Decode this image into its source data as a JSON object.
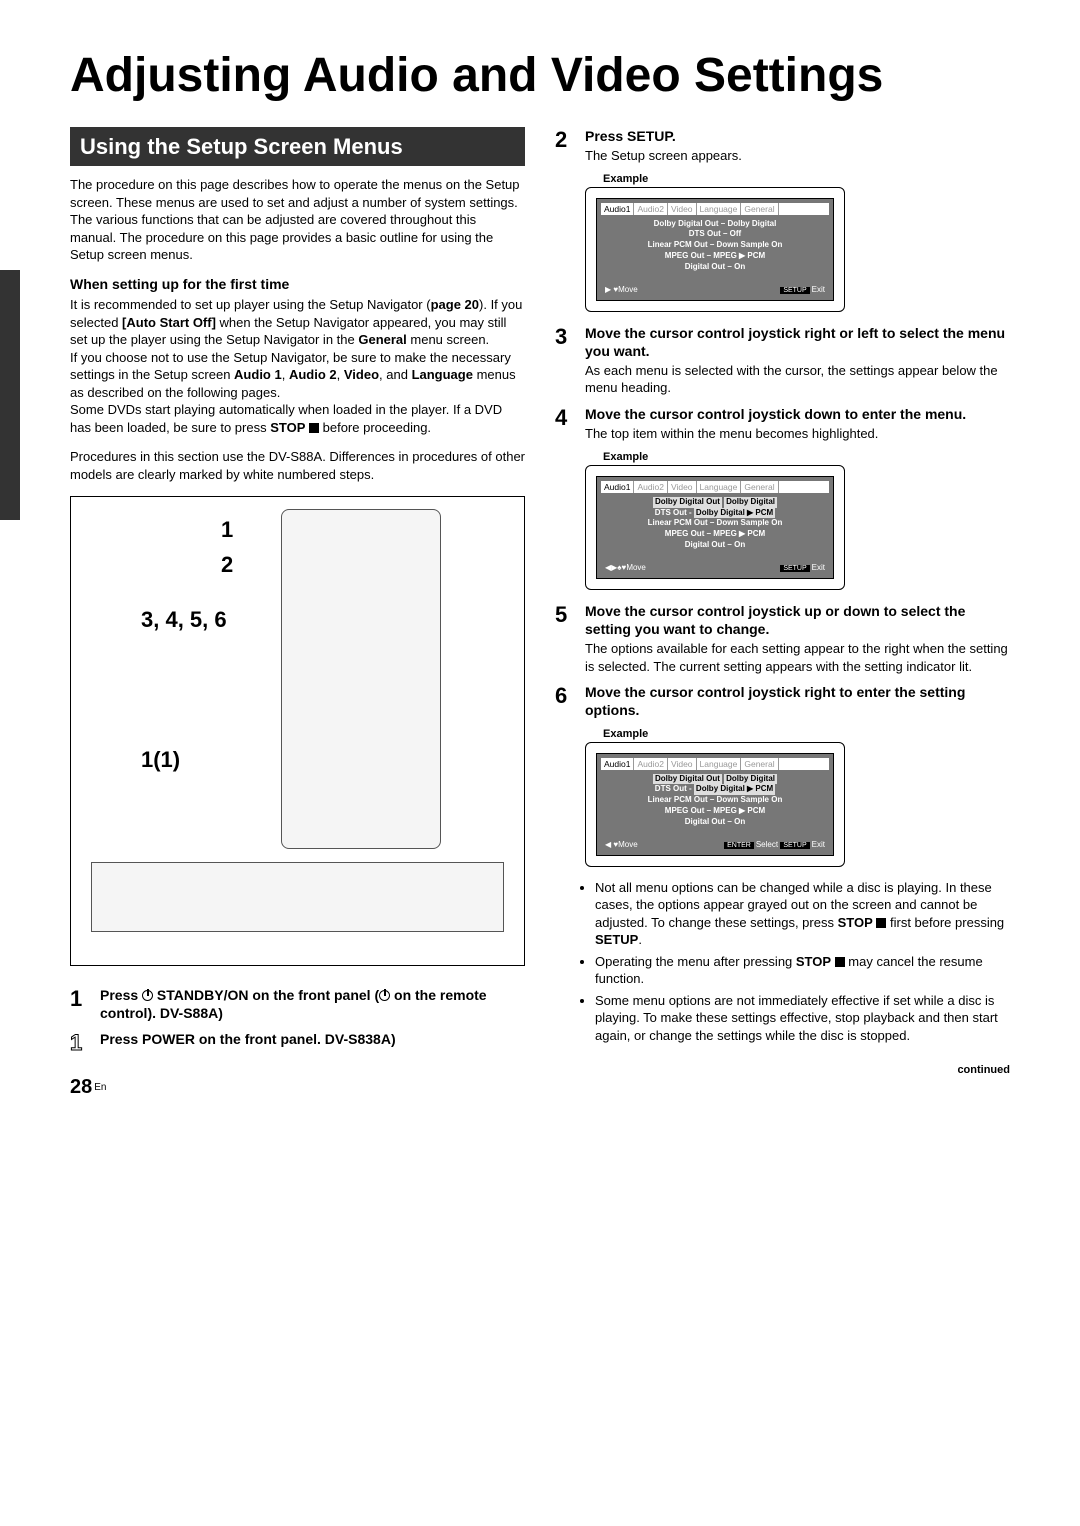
{
  "title": "Adjusting Audio and Video Settings",
  "section_header": "Using the Setup Screen Menus",
  "intro": "The procedure on this page describes how to operate the menus on the Setup screen. These menus are used to set and adjust a number of system settings. The various functions that can be adjusted are covered throughout this manual. The procedure on this page provides a basic outline for using the Setup screen menus.",
  "first_time_heading": "When setting up for the first time",
  "first_time_p1a": "It is recommended to set up player using the Setup Navigator (",
  "first_time_p1_ref": "page 20",
  "first_time_p1b": "). If you selected ",
  "first_time_p1_bold": "[Auto Start Off]",
  "first_time_p1c": " when the Setup Navigator appeared, you may still set up the player using the Setup Navigator in the ",
  "first_time_p1_bold2": "General",
  "first_time_p1d": " menu screen.",
  "first_time_p2": "If you choose not to use the Setup Navigator, be sure to make the necessary settings in the Setup screen ",
  "first_time_p2_bold": "Audio 1",
  "first_time_p2_bold2": "Audio 2",
  "first_time_p2_bold3": "Video",
  "first_time_p2_bold4": "Language",
  "first_time_p2_tail": " menus as described on the following pages.",
  "first_time_p3a": "Some DVDs start playing automatically when loaded in the player. If a DVD has been loaded, be sure to press ",
  "first_time_p3_bold": "STOP",
  "first_time_p3b": " before proceeding.",
  "procedures_note": "Procedures in this section use the DV-S88A. Differences in procedures of other models are clearly marked by white numbered steps.",
  "callouts": {
    "c1": "1",
    "c2": "2",
    "c3": "3, 4, 5, 6",
    "c4": "1(1)"
  },
  "step1": {
    "num": "1",
    "title_a": "Press  ",
    "title_b": " STANDBY/ON on the front panel (",
    "title_c": " on the remote control). DV-S88A)"
  },
  "step1alt": {
    "num": "1",
    "title": "Press  POWER on the front panel. DV-S838A)"
  },
  "step2": {
    "num": "2",
    "title": "Press SETUP.",
    "desc": "The Setup screen appears."
  },
  "step3": {
    "num": "3",
    "title": "Move the cursor control joystick right or left to select the menu you want.",
    "desc": "As each menu is selected with the cursor, the settings appear below the menu heading."
  },
  "step4": {
    "num": "4",
    "title": "Move the cursor control joystick down to enter the menu.",
    "desc": "The top item within the menu becomes highlighted."
  },
  "step5": {
    "num": "5",
    "title": "Move the cursor control joystick up or down to select the setting you want to change.",
    "desc": "The options available for each setting appear to the right when the setting is selected. The current setting appears with the setting indicator lit."
  },
  "step6": {
    "num": "6",
    "title": "Move the cursor control joystick right to enter the setting options."
  },
  "example_label": "Example",
  "tabs": [
    "Audio1",
    "Audio2",
    "Video",
    "Language",
    "General"
  ],
  "menu_a": {
    "l1": "Dolby Digital Out – Dolby Digital",
    "l2": "DTS Out – Off",
    "l3": "Linear PCM Out – Down Sample On",
    "l4": "MPEG Out – MPEG ▶ PCM",
    "l5": "Digital Out – On",
    "footer_left": "Move",
    "footer_right": "Exit",
    "footer_badge": "SETUP"
  },
  "menu_b": {
    "l1a": "Dolby Digital Out",
    "l1b": "Dolby Digital",
    "l2a": "DTS Out -",
    "l2b": "Dolby Digital ▶ PCM",
    "l3": "Linear PCM Out – Down Sample On",
    "l4": "MPEG Out – MPEG ▶ PCM",
    "l5": "Digital Out – On",
    "footer_left": "Move",
    "footer_right": "Exit",
    "footer_badge": "SETUP"
  },
  "menu_c": {
    "l1a": "Dolby Digital Out",
    "l1b": "Dolby Digital",
    "l2a": "DTS Out -",
    "l2b": "Dolby Digital ▶ PCM",
    "l3": "Linear PCM Out – Down Sample On",
    "l4": "MPEG Out – MPEG ▶ PCM",
    "l5": "Digital Out – On",
    "footer_left": "Move",
    "footer_mid": "Select",
    "footer_right": "Exit",
    "footer_badge1": "ENTER",
    "footer_badge2": "SETUP"
  },
  "notes": {
    "n1a": "Not all menu options can be changed while a disc is playing. In these cases, the options appear grayed out on the screen and cannot be adjusted. To change these settings, press ",
    "n1_bold1": "STOP",
    "n1b": " first before pressing ",
    "n1_bold2": "SETUP",
    "n1c": ".",
    "n2a": "Operating the menu after pressing ",
    "n2_bold": "STOP",
    "n2b": " may cancel the resume function.",
    "n3": "Some menu options are not immediately effective if set while a disc is playing. To make these settings effective, stop playback and then start again, or change the settings while the disc is stopped."
  },
  "page_number": "28",
  "page_lang": "En",
  "continued": "continued"
}
